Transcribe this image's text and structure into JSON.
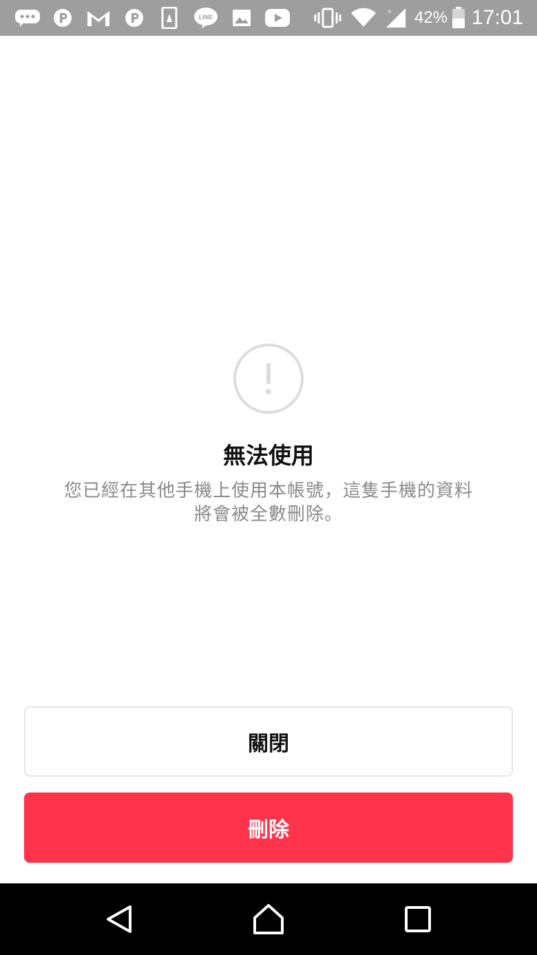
{
  "status_bar": {
    "battery_percent": "42%",
    "time": "17:01",
    "icons": [
      "chat-bubble-icon",
      "parking-app-icon",
      "gmail-icon",
      "parking-app-icon",
      "sim-app-icon",
      "line-icon",
      "image-icon",
      "youtube-icon",
      "vibrate-icon",
      "wifi-icon",
      "signal-icon",
      "battery-icon"
    ]
  },
  "dialog": {
    "icon": "exclamation-circle-icon",
    "title": "無法使用",
    "message": "您已經在其他手機上使用本帳號，這隻手機的資料將會被全數刪除。"
  },
  "buttons": {
    "close_label": "關閉",
    "delete_label": "刪除"
  },
  "colors": {
    "accent_red": "#ff334b",
    "status_bar_bg": "#9e9e9e",
    "icon_gray": "#dcdcdc",
    "message_text": "#8a8a8a"
  },
  "nav_bar": {
    "buttons": [
      "back-icon",
      "home-icon",
      "recents-icon"
    ]
  }
}
